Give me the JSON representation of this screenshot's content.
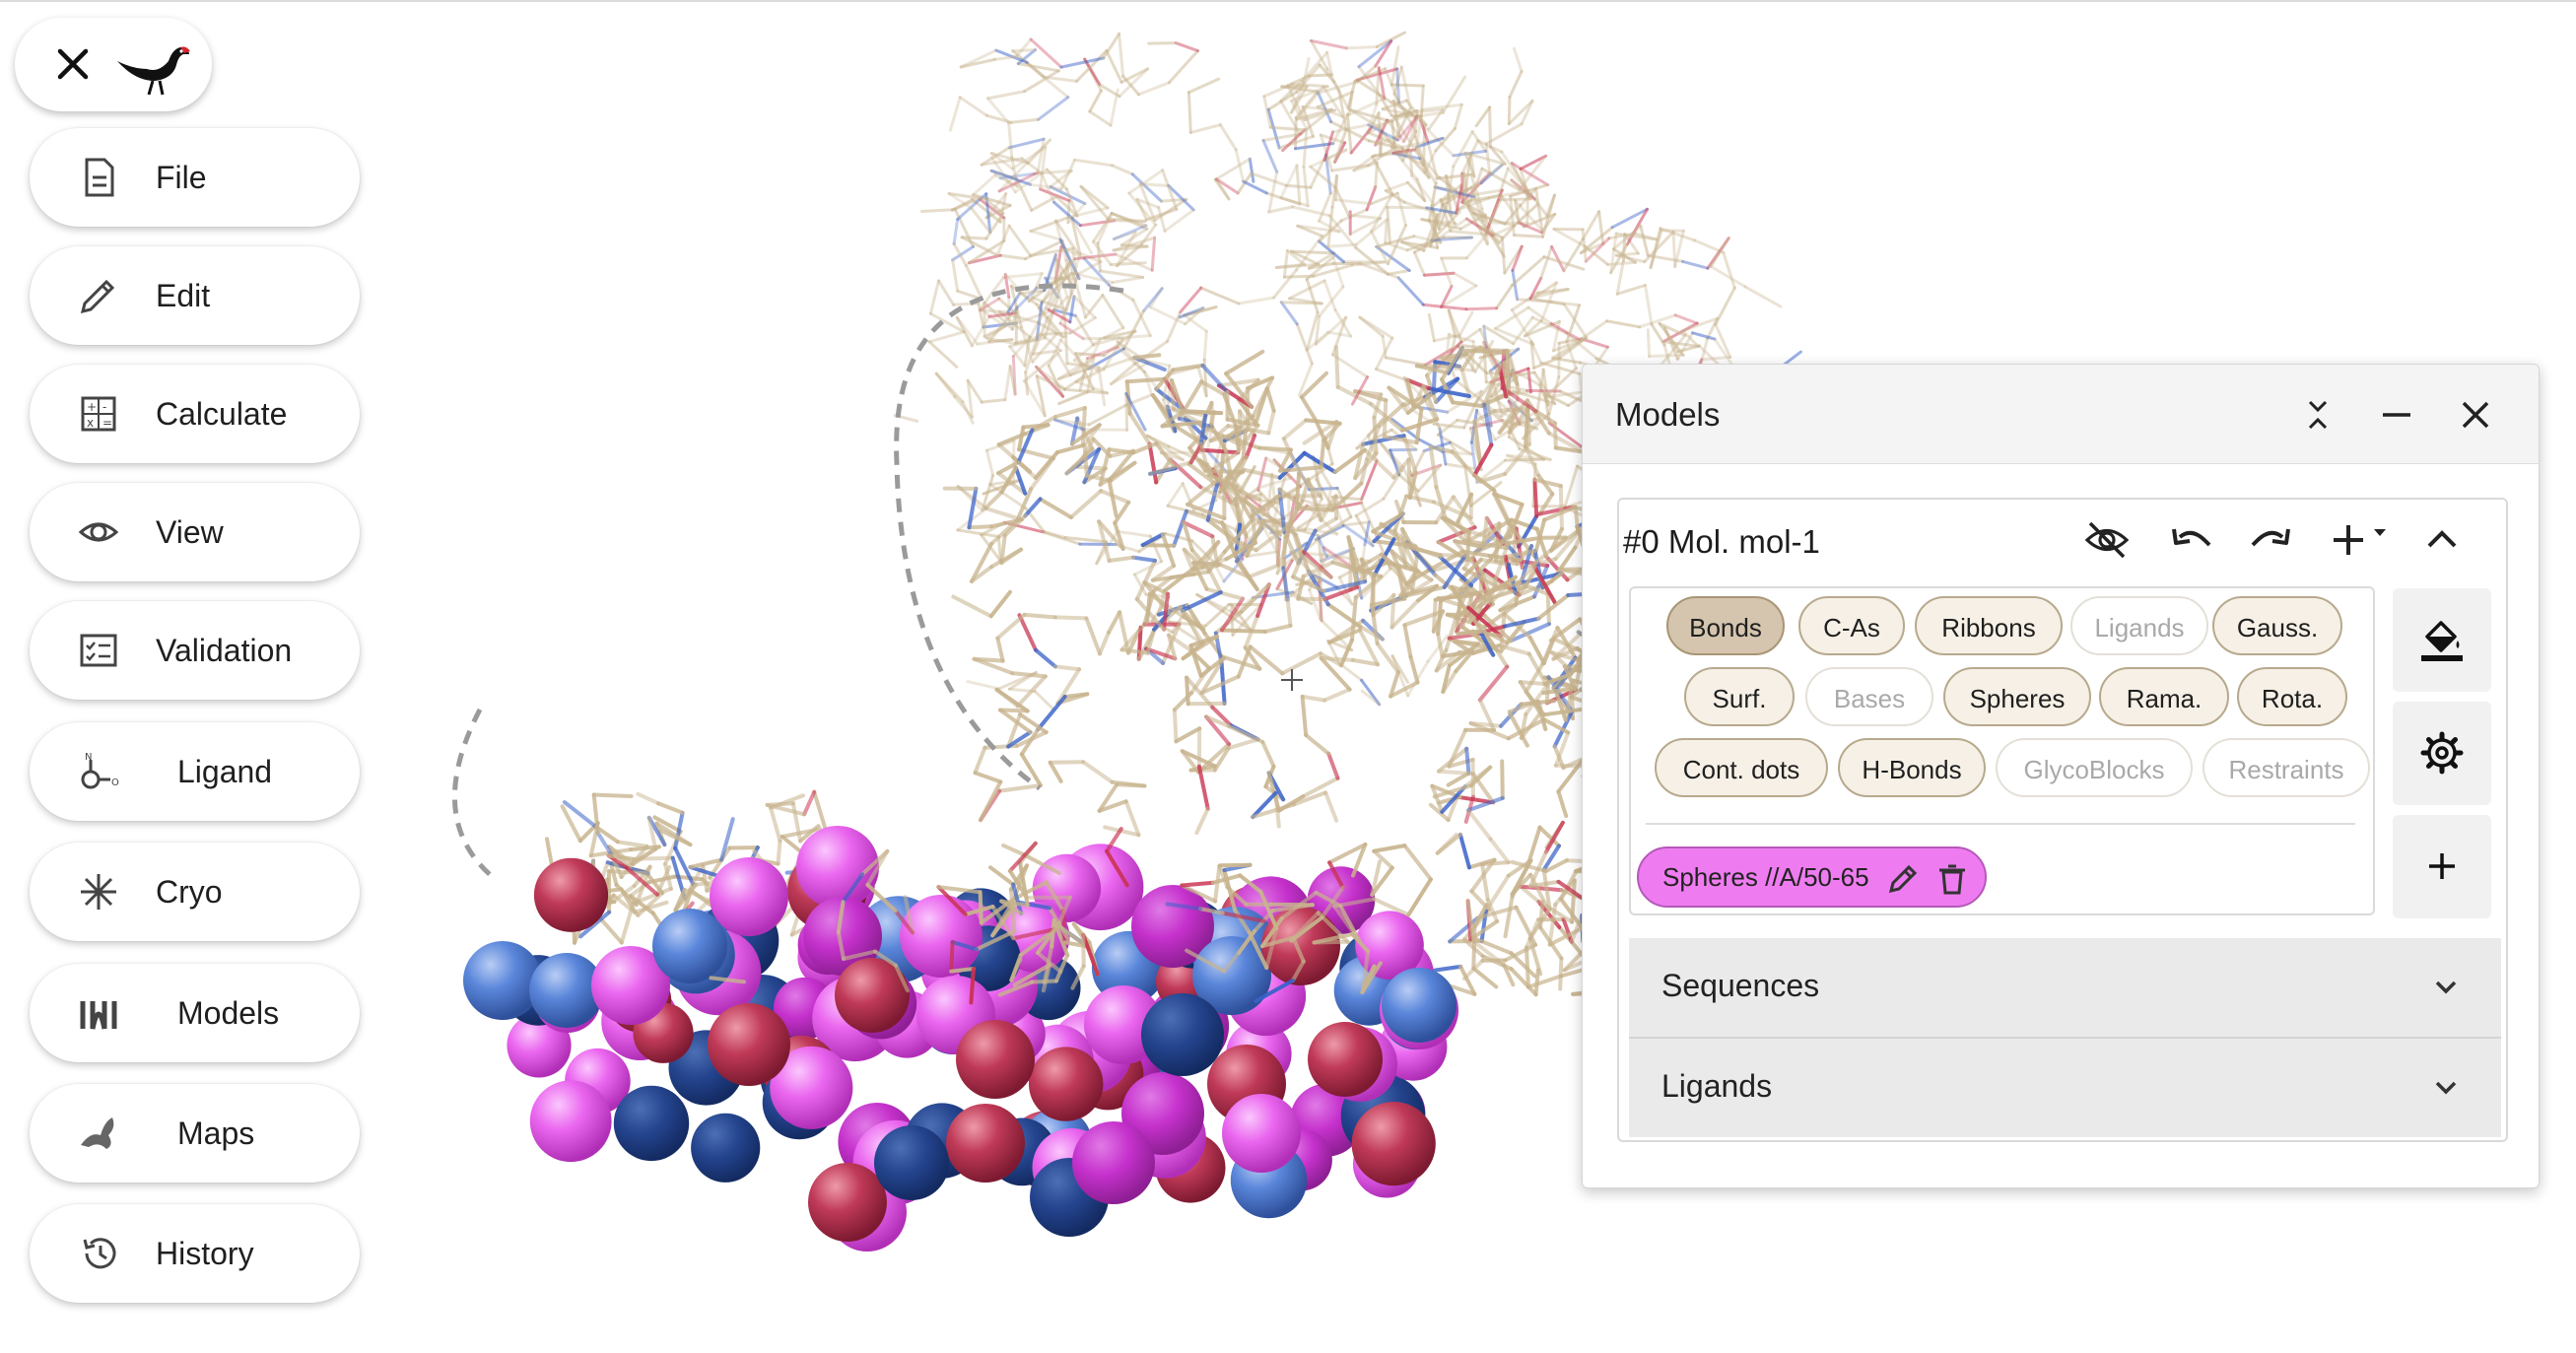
{
  "app": {
    "menu": [
      {
        "label": "File",
        "icon": "file-icon"
      },
      {
        "label": "Edit",
        "icon": "pencil-icon"
      },
      {
        "label": "Calculate",
        "icon": "calculator-icon"
      },
      {
        "label": "View",
        "icon": "eye-icon"
      },
      {
        "label": "Validation",
        "icon": "checklist-icon"
      },
      {
        "label": "Ligand",
        "icon": "molecule-icon"
      },
      {
        "label": "Cryo",
        "icon": "snowflake-icon"
      },
      {
        "label": "Models",
        "icon": "models-icon"
      },
      {
        "label": "Maps",
        "icon": "maps-icon"
      },
      {
        "label": "History",
        "icon": "history-icon"
      }
    ]
  },
  "models_panel": {
    "title": "Models",
    "model": {
      "title": "#0 Mol. mol-1",
      "representations": [
        {
          "label": "Bonds",
          "state": "active"
        },
        {
          "label": "C-As",
          "state": "inactive"
        },
        {
          "label": "Ribbons",
          "state": "inactive"
        },
        {
          "label": "Ligands",
          "state": "disabled"
        },
        {
          "label": "Gauss.",
          "state": "inactive"
        },
        {
          "label": "Surf.",
          "state": "inactive"
        },
        {
          "label": "Bases",
          "state": "disabled"
        },
        {
          "label": "Spheres",
          "state": "inactive"
        },
        {
          "label": "Rama.",
          "state": "inactive"
        },
        {
          "label": "Rota.",
          "state": "inactive"
        },
        {
          "label": "Cont. dots",
          "state": "inactive"
        },
        {
          "label": "H-Bonds",
          "state": "inactive"
        },
        {
          "label": "GlycoBlocks",
          "state": "disabled"
        },
        {
          "label": "Restraints",
          "state": "disabled"
        }
      ],
      "custom_representation": {
        "label": "Spheres //A/50-65",
        "color": "#ee7cf0"
      }
    },
    "accordions": [
      {
        "label": "Sequences"
      },
      {
        "label": "Ligands"
      }
    ]
  },
  "colors": {
    "bond_carbon": "#c8b48e",
    "nitrogen": "#3a62c8",
    "oxygen": "#c9324f",
    "sphere_magenta": "#e04fe6",
    "sphere_blue": "#4f7fd6",
    "sphere_red": "#b6304c"
  }
}
